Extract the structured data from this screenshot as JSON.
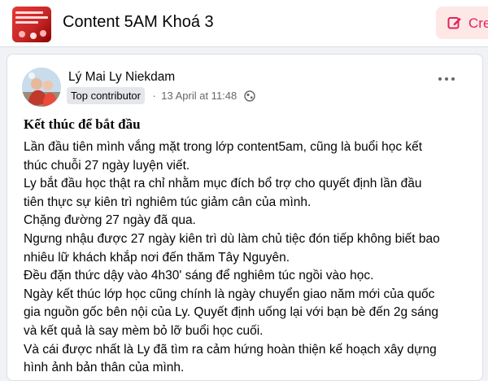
{
  "header": {
    "group_name": "Content 5AM Khoá 3",
    "thumbnail_text": "27 Ngày Luyện Viết Thấu Hiểu Bản Thân",
    "create_button_label": "Cre",
    "create_icon": "edit-icon",
    "accent_color": "#e0245e"
  },
  "post": {
    "author": "Lý Mai Ly Niekdam",
    "badge": "Top contributor",
    "separator": "·",
    "timestamp": "13 April at 11:48",
    "audience_icon": "globe-icon",
    "more_icon": "more-options-icon",
    "title": "Kết thúc để bắt đầu",
    "lines": [
      "Lần đầu tiên mình vắng mặt trong lớp content5am, cũng là buổi học kết",
      "thúc chuỗi 27 ngày luyện viết.",
      "Ly bắt đầu học thật ra chỉ nhằm mục đích bổ trợ cho quyết định lần đầu",
      "tiên thực sự kiên trì nghiêm túc giảm cân của mình.",
      "Chặng đường 27 ngày đã qua.",
      "Ngưng nhậu được 27 ngày kiên trì dù làm chủ tiệc đón tiếp không biết bao",
      "nhiêu lữ khách khắp nơi đến thăm Tây Nguyên.",
      "Đều đặn thức dậy vào 4h30' sáng để nghiêm túc ngồi vào học.",
      "Ngày kết thúc lớp học cũng chính là ngày chuyển giao năm mới của quốc",
      "gia nguồn gốc bên nội của Ly. Quyết định uống lại với bạn bè đến 2g sáng",
      "và kết quả là say mèm bỏ lỡ buổi học cuối.",
      "Và cái được nhất là Ly đã tìm ra cảm hứng hoàn thiện kế hoạch xây dựng",
      "hình ảnh bản thân của mình."
    ]
  }
}
